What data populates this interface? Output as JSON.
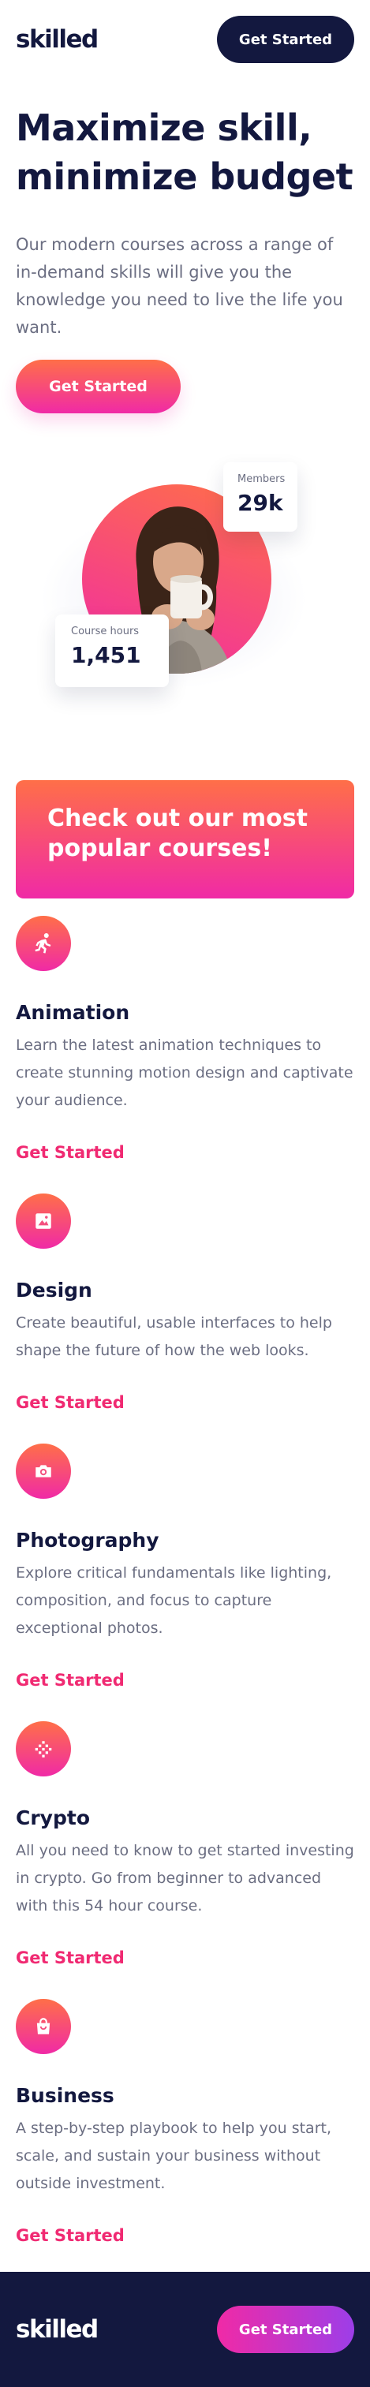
{
  "header": {
    "logo": "skilled",
    "cta_label": "Get Started"
  },
  "hero": {
    "title": "Maximize skill, minimize budget",
    "description": "Our modern courses across a range of in-demand skills will give you the knowledge you need to live the life you want.",
    "cta_label": "Get Started"
  },
  "stats": {
    "members_label": "Members",
    "members_value": "29k",
    "hours_label": "Course hours",
    "hours_value": "1,451"
  },
  "promo": {
    "text": "Check out our most popular courses!"
  },
  "courses": [
    {
      "title": "Animation",
      "description": "Learn the latest animation techniques to create stunning motion design and captivate your audience.",
      "link": "Get Started",
      "icon": "running-figure-icon"
    },
    {
      "title": "Design",
      "description": "Create beautiful, usable interfaces to help shape the future of how the web looks.",
      "link": "Get Started",
      "icon": "image-frame-icon"
    },
    {
      "title": "Photography",
      "description": "Explore critical fundamentals like lighting, composition, and focus to capture exceptional photos.",
      "link": "Get Started",
      "icon": "camera-icon"
    },
    {
      "title": "Crypto",
      "description": "All you need to know to get started investing in crypto. Go from beginner to advanced with this 54 hour course.",
      "link": "Get Started",
      "icon": "crypto-dots-icon"
    },
    {
      "title": "Business",
      "description": "A step-by-step playbook to help you start, scale, and sustain your business without outside investment.",
      "link": "Get Started",
      "icon": "shopping-bag-icon"
    }
  ],
  "footer": {
    "logo": "skilled",
    "cta_label": "Get Started"
  },
  "colors": {
    "navy": "#13183f",
    "orange": "#ff6f48",
    "pink": "#f02aa6",
    "link_pink": "#f02a72",
    "purple": "#9d3ee8",
    "gray_text": "#6b6e82"
  }
}
